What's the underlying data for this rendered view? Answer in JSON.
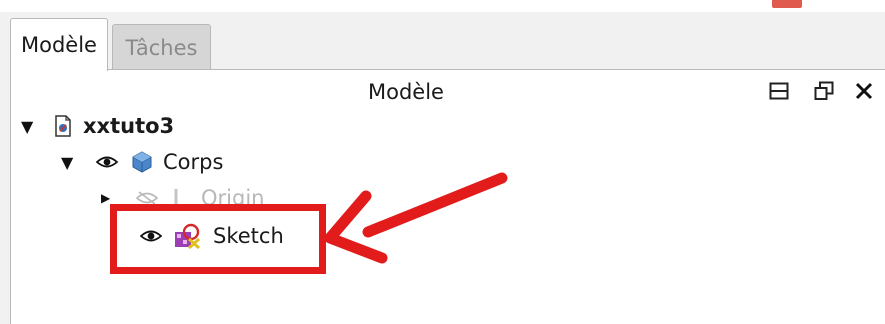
{
  "tabs": [
    {
      "label": "Modèle",
      "active": true
    },
    {
      "label": "Tâches",
      "active": false
    }
  ],
  "panel": {
    "title": "Modèle"
  },
  "window_buttons": [
    {
      "name": "dock-toggle-icon"
    },
    {
      "name": "float-icon"
    },
    {
      "name": "close-icon",
      "glyph": "✕"
    }
  ],
  "tree": {
    "document": {
      "label": "xxtuto3",
      "expanded": true
    },
    "body": {
      "label": "Corps",
      "expanded": true
    },
    "origin": {
      "label": "Origin",
      "expanded": false,
      "hidden": true
    },
    "sketch": {
      "label": "Sketch"
    }
  },
  "annotation": {
    "color": "#e21b1b",
    "target": "Sketch"
  },
  "colors": {
    "accent": "#e21b1b",
    "panel_bg": "#ffffff",
    "tab_inactive_bg": "#d6d6d6"
  }
}
